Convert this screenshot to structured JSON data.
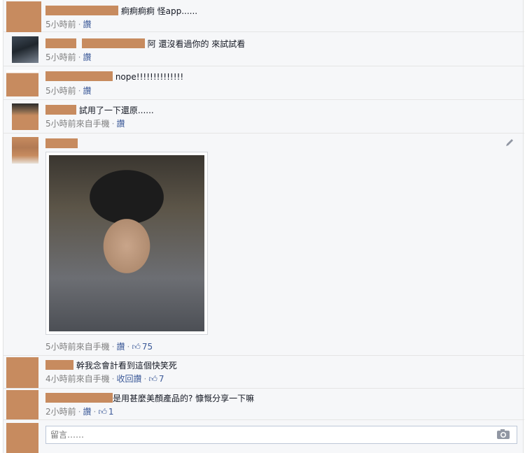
{
  "comments": [
    {
      "text": "痾痾痾痾 怪app......",
      "time": "5小時前",
      "via": "",
      "read": "讚",
      "likes": ""
    },
    {
      "text": "阿 還沒看過你的 來試試看",
      "time": "5小時前",
      "via": "",
      "read": "讚",
      "likes": ""
    },
    {
      "text": "nope!!!!!!!!!!!!!!",
      "time": "5小時前",
      "via": "",
      "read": "讚",
      "likes": ""
    },
    {
      "text": "試用了一下還原......",
      "time": "5小時前",
      "via": "來自手機",
      "read": "讚",
      "likes": ""
    },
    {
      "text": "",
      "time": "5小時前",
      "via": "來自手機",
      "read": "讚",
      "likes": "75"
    },
    {
      "text": "幹我念會計看到這個快笑死",
      "time": "4小時前",
      "via": "來自手機",
      "read": "收回讚",
      "likes": "7"
    },
    {
      "text": "是用甚麼美顏產品的? 慷慨分享一下嘛",
      "time": "2小時前",
      "via": "",
      "read": "讚",
      "likes": "1"
    }
  ],
  "composer": {
    "placeholder": "留言……"
  },
  "icons": {
    "edit": "pencil-icon",
    "camera": "camera-icon",
    "like": "thumbs-up-icon"
  },
  "colors": {
    "link": "#3b5998",
    "redaction": "#c78b5f",
    "meta": "#7f7f7f"
  }
}
